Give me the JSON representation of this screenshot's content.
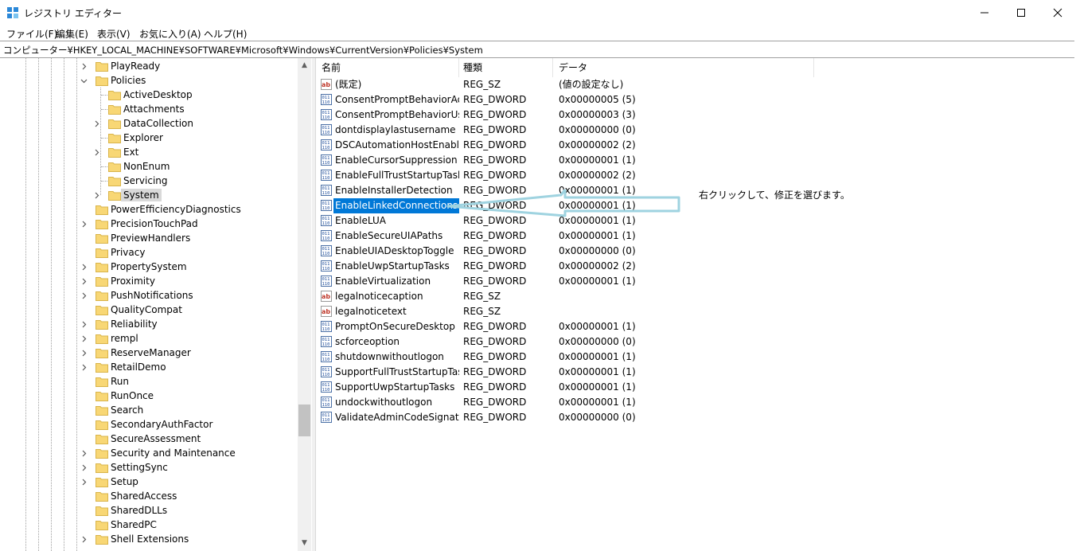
{
  "window": {
    "title": "レジストリ エディター",
    "icon": "regedit-icon",
    "controls": [
      "minimize-icon",
      "maximize-icon",
      "close-icon"
    ]
  },
  "menu": [
    "ファイル(F)",
    "編集(E)",
    "表示(V)",
    "お気に入り(A)",
    "ヘルプ(H)"
  ],
  "address": "コンピューター¥HKEY_LOCAL_MACHINE¥SOFTWARE¥Microsoft¥Windows¥CurrentVersion¥Policies¥System",
  "tree": [
    {
      "label": "PlayReady",
      "level": 0,
      "expander": "collapsed"
    },
    {
      "label": "Policies",
      "level": 0,
      "expander": "expanded"
    },
    {
      "label": "ActiveDesktop",
      "level": 1,
      "expander": "none"
    },
    {
      "label": "Attachments",
      "level": 1,
      "expander": "none"
    },
    {
      "label": "DataCollection",
      "level": 1,
      "expander": "collapsed"
    },
    {
      "label": "Explorer",
      "level": 1,
      "expander": "none"
    },
    {
      "label": "Ext",
      "level": 1,
      "expander": "collapsed"
    },
    {
      "label": "NonEnum",
      "level": 1,
      "expander": "none"
    },
    {
      "label": "Servicing",
      "level": 1,
      "expander": "none"
    },
    {
      "label": "System",
      "level": 1,
      "expander": "collapsed",
      "selected": true
    },
    {
      "label": "PowerEfficiencyDiagnostics",
      "level": 0,
      "expander": "none"
    },
    {
      "label": "PrecisionTouchPad",
      "level": 0,
      "expander": "collapsed"
    },
    {
      "label": "PreviewHandlers",
      "level": 0,
      "expander": "none"
    },
    {
      "label": "Privacy",
      "level": 0,
      "expander": "none"
    },
    {
      "label": "PropertySystem",
      "level": 0,
      "expander": "collapsed"
    },
    {
      "label": "Proximity",
      "level": 0,
      "expander": "collapsed"
    },
    {
      "label": "PushNotifications",
      "level": 0,
      "expander": "collapsed"
    },
    {
      "label": "QualityCompat",
      "level": 0,
      "expander": "none"
    },
    {
      "label": "Reliability",
      "level": 0,
      "expander": "collapsed"
    },
    {
      "label": "rempl",
      "level": 0,
      "expander": "collapsed"
    },
    {
      "label": "ReserveManager",
      "level": 0,
      "expander": "collapsed"
    },
    {
      "label": "RetailDemo",
      "level": 0,
      "expander": "collapsed"
    },
    {
      "label": "Run",
      "level": 0,
      "expander": "none"
    },
    {
      "label": "RunOnce",
      "level": 0,
      "expander": "none"
    },
    {
      "label": "Search",
      "level": 0,
      "expander": "none"
    },
    {
      "label": "SecondaryAuthFactor",
      "level": 0,
      "expander": "none"
    },
    {
      "label": "SecureAssessment",
      "level": 0,
      "expander": "none"
    },
    {
      "label": "Security and Maintenance",
      "level": 0,
      "expander": "collapsed"
    },
    {
      "label": "SettingSync",
      "level": 0,
      "expander": "collapsed"
    },
    {
      "label": "Setup",
      "level": 0,
      "expander": "collapsed"
    },
    {
      "label": "SharedAccess",
      "level": 0,
      "expander": "none"
    },
    {
      "label": "SharedDLLs",
      "level": 0,
      "expander": "none"
    },
    {
      "label": "SharedPC",
      "level": 0,
      "expander": "none"
    },
    {
      "label": "Shell Extensions",
      "level": 0,
      "expander": "collapsed"
    }
  ],
  "columns": [
    "名前",
    "種類",
    "データ"
  ],
  "values": [
    {
      "name": "(既定)",
      "type": "REG_SZ",
      "data": "(値の設定なし)",
      "icon": "ab"
    },
    {
      "name": "ConsentPromptBehaviorAd...",
      "type": "REG_DWORD",
      "data": "0x00000005 (5)",
      "icon": "bin"
    },
    {
      "name": "ConsentPromptBehaviorUser",
      "type": "REG_DWORD",
      "data": "0x00000003 (3)",
      "icon": "bin"
    },
    {
      "name": "dontdisplaylastusername",
      "type": "REG_DWORD",
      "data": "0x00000000 (0)",
      "icon": "bin"
    },
    {
      "name": "DSCAutomationHostEnabled",
      "type": "REG_DWORD",
      "data": "0x00000002 (2)",
      "icon": "bin"
    },
    {
      "name": "EnableCursorSuppression",
      "type": "REG_DWORD",
      "data": "0x00000001 (1)",
      "icon": "bin"
    },
    {
      "name": "EnableFullTrustStartupTasks",
      "type": "REG_DWORD",
      "data": "0x00000002 (2)",
      "icon": "bin"
    },
    {
      "name": "EnableInstallerDetection",
      "type": "REG_DWORD",
      "data": "0x00000001 (1)",
      "icon": "bin"
    },
    {
      "name": "EnableLinkedConnections",
      "type": "REG_DWORD",
      "data": "0x00000001 (1)",
      "icon": "bin",
      "selected": true
    },
    {
      "name": "EnableLUA",
      "type": "REG_DWORD",
      "data": "0x00000001 (1)",
      "icon": "bin"
    },
    {
      "name": "EnableSecureUIAPaths",
      "type": "REG_DWORD",
      "data": "0x00000001 (1)",
      "icon": "bin"
    },
    {
      "name": "EnableUIADesktopToggle",
      "type": "REG_DWORD",
      "data": "0x00000000 (0)",
      "icon": "bin"
    },
    {
      "name": "EnableUwpStartupTasks",
      "type": "REG_DWORD",
      "data": "0x00000002 (2)",
      "icon": "bin"
    },
    {
      "name": "EnableVirtualization",
      "type": "REG_DWORD",
      "data": "0x00000001 (1)",
      "icon": "bin"
    },
    {
      "name": "legalnoticecaption",
      "type": "REG_SZ",
      "data": "",
      "icon": "ab"
    },
    {
      "name": "legalnoticetext",
      "type": "REG_SZ",
      "data": "",
      "icon": "ab"
    },
    {
      "name": "PromptOnSecureDesktop",
      "type": "REG_DWORD",
      "data": "0x00000001 (1)",
      "icon": "bin"
    },
    {
      "name": "scforceoption",
      "type": "REG_DWORD",
      "data": "0x00000000 (0)",
      "icon": "bin"
    },
    {
      "name": "shutdownwithoutlogon",
      "type": "REG_DWORD",
      "data": "0x00000001 (1)",
      "icon": "bin"
    },
    {
      "name": "SupportFullTrustStartupTasks",
      "type": "REG_DWORD",
      "data": "0x00000001 (1)",
      "icon": "bin"
    },
    {
      "name": "SupportUwpStartupTasks",
      "type": "REG_DWORD",
      "data": "0x00000001 (1)",
      "icon": "bin"
    },
    {
      "name": "undockwithoutlogon",
      "type": "REG_DWORD",
      "data": "0x00000001 (1)",
      "icon": "bin"
    },
    {
      "name": "ValidateAdminCodeSignatu...",
      "type": "REG_DWORD",
      "data": "0x00000000 (0)",
      "icon": "bin"
    }
  ],
  "annotation": {
    "text": "右クリックして、修正を選びます。",
    "arrow_color": "#9fd3e0"
  },
  "colors": {
    "selection": "#0078d7",
    "tree_selection": "#d9d9d9",
    "folder": "#f8d775"
  }
}
